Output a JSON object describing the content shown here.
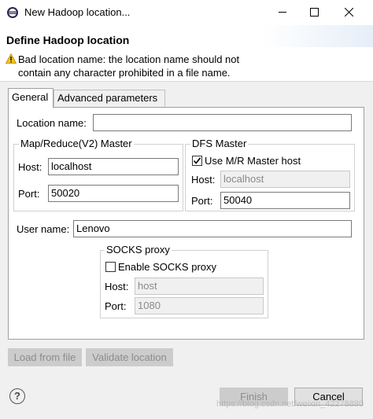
{
  "window": {
    "title": "New Hadoop location..."
  },
  "header": {
    "title": "Define Hadoop location",
    "warning_line1": "Bad location name: the location name should not",
    "warning_line2": "contain any character prohibited in a file name."
  },
  "tabs": [
    {
      "label": "General"
    },
    {
      "label": "Advanced parameters"
    }
  ],
  "general": {
    "location_name_label": "Location name:",
    "location_name_value": "",
    "mapreduce": {
      "title": "Map/Reduce(V2) Master",
      "host_label": "Host:",
      "host_value": "localhost",
      "port_label": "Port:",
      "port_value": "50020"
    },
    "dfs": {
      "title": "DFS Master",
      "use_mr_label": "Use M/R Master host",
      "use_mr_checked": true,
      "host_label": "Host:",
      "host_value": "localhost",
      "port_label": "Port:",
      "port_value": "50040"
    },
    "user_name_label": "User name:",
    "user_name_value": "Lenovo",
    "socks": {
      "title": "SOCKS proxy",
      "enable_label": "Enable SOCKS proxy",
      "enable_checked": false,
      "host_label": "Host:",
      "host_value": "host",
      "port_label": "Port:",
      "port_value": "1080"
    }
  },
  "buttons": {
    "load_from_file": "Load from file",
    "validate_location": "Validate location",
    "finish": "Finish",
    "cancel": "Cancel",
    "help": "?"
  },
  "watermark": "https://blog.csdn.net/weixin_42278880",
  "icons": {
    "app": "eclipse-icon",
    "warning": "warning-icon",
    "minimize": "minimize-icon",
    "maximize": "maximize-icon",
    "close": "close-icon",
    "help": "help-icon"
  }
}
